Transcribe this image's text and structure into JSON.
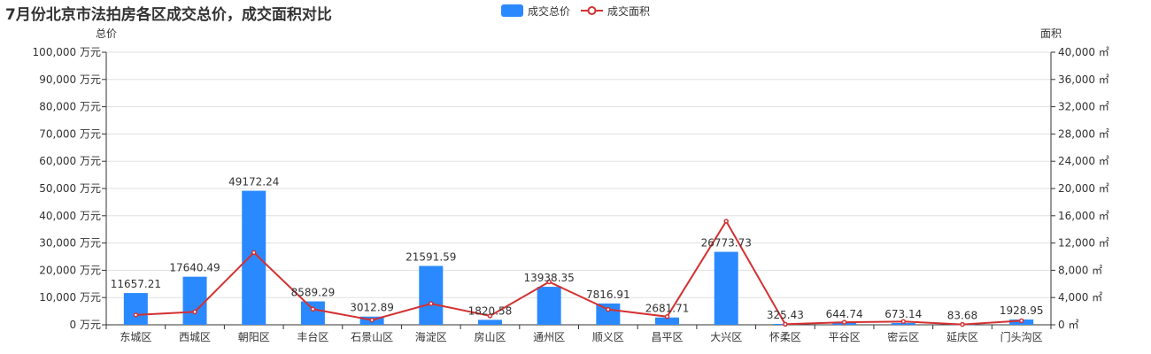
{
  "chart_data": {
    "type": "bar",
    "title": "7月份北京市法拍房各区成交总价，成交面积对比",
    "categories": [
      "东城区",
      "西城区",
      "朝阳区",
      "丰台区",
      "石景山区",
      "海淀区",
      "房山区",
      "通州区",
      "顺义区",
      "昌平区",
      "大兴区",
      "怀柔区",
      "平谷区",
      "密云区",
      "延庆区",
      "门头沟区"
    ],
    "series": [
      {
        "name": "成交总价",
        "type": "bar",
        "axis": "left",
        "color": "#2b89ff",
        "values": [
          11657.21,
          17640.49,
          49172.24,
          8589.29,
          3012.89,
          21591.59,
          1820.58,
          13938.35,
          7816.91,
          2681.71,
          26773.73,
          325.43,
          644.74,
          673.14,
          83.68,
          1928.95
        ],
        "labels": [
          "11657.21",
          "17640.49",
          "49172.24",
          "8589.29",
          "3012.89",
          "21591.59",
          "1820.58",
          "13938.35",
          "7816.91",
          "2681.71",
          "26773.73",
          "325.43",
          "644.74",
          "673.14",
          "83.68",
          "1928.95"
        ]
      },
      {
        "name": "成交面积",
        "type": "line",
        "axis": "right",
        "color": "#d33131",
        "values": [
          1450,
          1900,
          10600,
          2300,
          700,
          3100,
          1300,
          6300,
          2250,
          1200,
          15200,
          80,
          380,
          480,
          50,
          600
        ]
      }
    ],
    "y_left": {
      "name": "总价",
      "min": 0,
      "max": 100000,
      "interval": 10000,
      "tick_labels": [
        "0 万元",
        "10,000 万元",
        "20,000 万元",
        "30,000 万元",
        "40,000 万元",
        "50,000 万元",
        "60,000 万元",
        "70,000 万元",
        "80,000 万元",
        "90,000 万元",
        "100,000 万元"
      ]
    },
    "y_right": {
      "name": "面积",
      "min": 0,
      "max": 40000,
      "interval": 4000,
      "tick_labels": [
        "0 ㎡",
        "4,000 ㎡",
        "8,000 ㎡",
        "12,000 ㎡",
        "16,000 ㎡",
        "20,000 ㎡",
        "24,000 ㎡",
        "28,000 ㎡",
        "32,000 ㎡",
        "36,000 ㎡",
        "40,000 ㎡"
      ]
    },
    "grid": true,
    "legend_position": "top-center"
  }
}
